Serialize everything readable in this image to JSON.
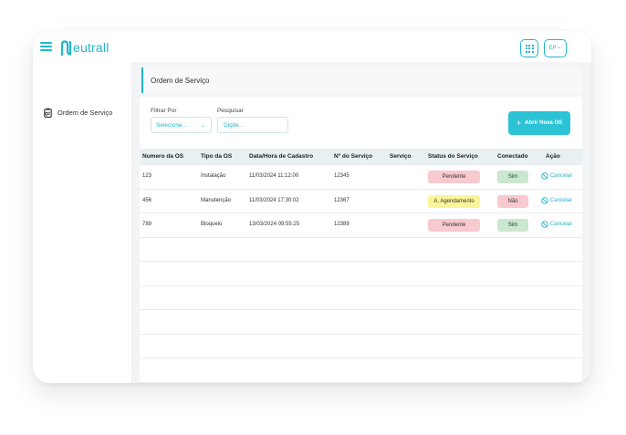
{
  "app": {
    "brand_first": "N",
    "brand_rest": "eutrall"
  },
  "header": {
    "user_initials": "EP",
    "user_chevron": "⌄"
  },
  "sidebar": {
    "items": [
      {
        "label": "Ordem de Serviço",
        "icon": "clipboard-icon"
      }
    ]
  },
  "page": {
    "title": "Ordem de Serviço"
  },
  "filters": {
    "filter_label": "Filtrar Por",
    "filter_value": "Selecione...",
    "search_label": "Pesquisar",
    "search_placeholder": "Digite..."
  },
  "actions": {
    "new_order_label": "Abrir Nova OS"
  },
  "colors": {
    "accent": "#1fb6c9",
    "pending_bg": "#f8c9cf",
    "scheduling_bg": "#fbf59a",
    "yes_bg": "#c9e8cf",
    "no_bg": "#f8c9cf"
  },
  "table": {
    "columns": [
      "Numero da OS",
      "Tipo da OS",
      "Data/Hora de Cadastro",
      "Nº do Serviço",
      "Serviço",
      "Status do Serviço",
      "Conectado",
      "Ação"
    ],
    "rows": [
      {
        "numero": "123",
        "tipo": "Instalação",
        "data": "11/03/2024 11:12:00",
        "n_servico": "12345",
        "servico": "",
        "status": "Pendente",
        "status_type": "pending",
        "conectado": "Sim",
        "conectado_type": "yes",
        "acao": "Cancelar"
      },
      {
        "numero": "456",
        "tipo": "Manutenção",
        "data": "11/03/2024 17:30:02",
        "n_servico": "12367",
        "servico": "",
        "status": "A. Agendamento",
        "status_type": "scheduling",
        "conectado": "Não",
        "conectado_type": "no",
        "acao": "Cancelar"
      },
      {
        "numero": "789",
        "tipo": "Bloqueio",
        "data": "13/03/2024 09:55:25",
        "n_servico": "12389",
        "servico": "",
        "status": "Pendente",
        "status_type": "pending",
        "conectado": "Sim",
        "conectado_type": "yes",
        "acao": "Cancelar"
      }
    ]
  }
}
